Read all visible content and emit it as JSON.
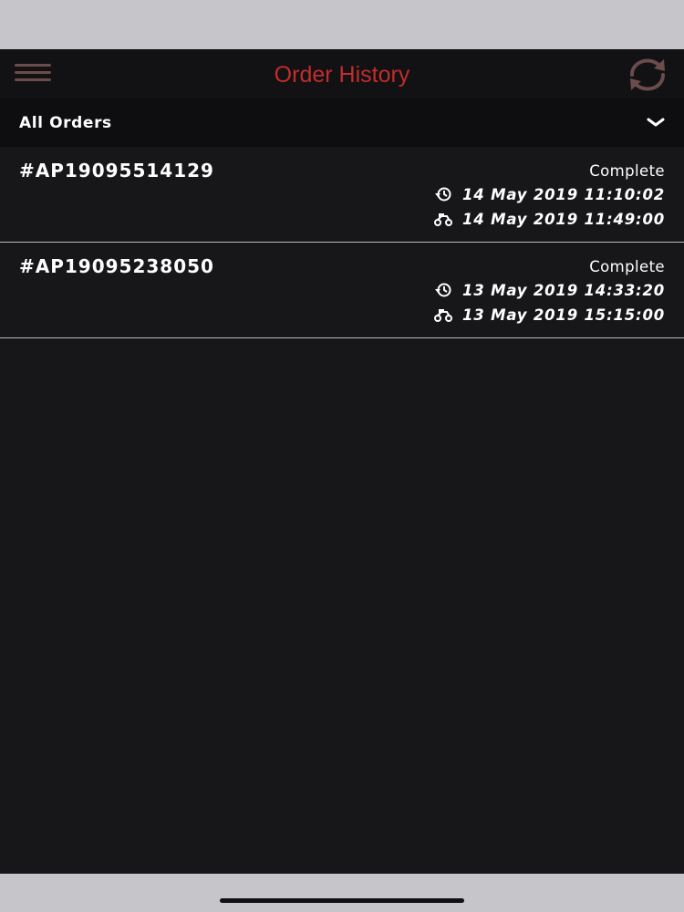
{
  "header": {
    "title": "Order History",
    "menu_icon": "hamburger-menu-icon",
    "refresh_icon": "refresh-icon",
    "title_color": "#c22d2d",
    "icon_color": "#6b4b4b"
  },
  "filter": {
    "selected": "All Orders",
    "dropdown_icon": "chevron-down-icon"
  },
  "orders": [
    {
      "id": "#AP19095514129",
      "status": "Complete",
      "ordered_time": "14 May 2019 11:10:02",
      "delivered_time": "14 May 2019 11:49:00"
    },
    {
      "id": "#AP19095238050",
      "status": "Complete",
      "ordered_time": "13 May 2019 14:33:20",
      "delivered_time": "13 May 2019 15:15:00"
    }
  ],
  "icons": {
    "ordered_time": "history-clock-icon",
    "delivered_time": "delivery-scooter-icon"
  }
}
